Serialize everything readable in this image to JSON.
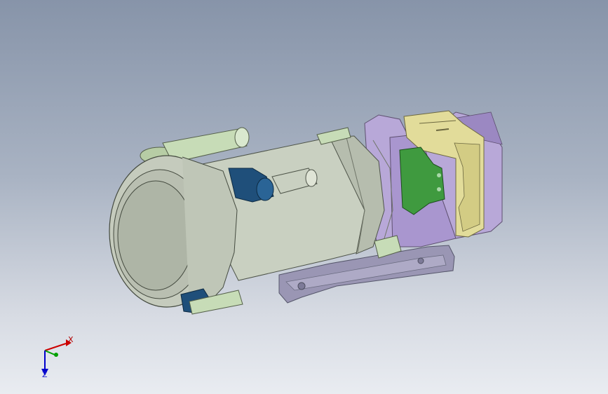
{
  "viewport": {
    "background_top": "#8794a9",
    "background_bottom": "#e9ecf1"
  },
  "model": {
    "colors": {
      "barrel": "#c9d0c1",
      "barrel_shade": "#a9b0a3",
      "lens_ring": "#c5cbbd",
      "base_plate": "#9a96b4",
      "housing": "#b8a8d8",
      "housing_dark": "#9b88c2",
      "bracket_yellow": "#e2dc9a",
      "circuit_green": "#3f9a3f",
      "motor_blue": "#1f4f7a",
      "motor_green": "#c7dcb7"
    }
  },
  "triad": {
    "x_label": "X",
    "z_label": "Z",
    "x_color": "#cc0000",
    "y_color": "#00a000",
    "z_color": "#0000cc"
  }
}
